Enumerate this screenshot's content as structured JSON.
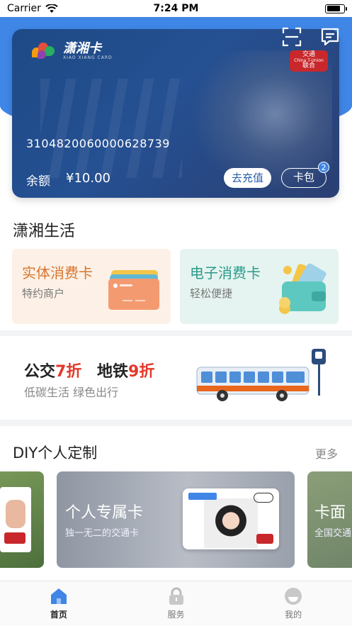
{
  "status_bar": {
    "carrier": "Carrier",
    "time": "7:24 PM"
  },
  "card": {
    "brand": "潇湘卡",
    "brand_sub": "XIAO XIANG CARD",
    "union_badge": [
      "交通",
      "China T-Union",
      "联合"
    ],
    "number": "3104820060000628739",
    "balance_label": "余额",
    "balance_value": "¥10.00",
    "recharge_label": "去充值",
    "wallet_label": "卡包",
    "wallet_count": "2"
  },
  "life": {
    "title": "潇湘生活",
    "physical": {
      "title": "实体消费卡",
      "subtitle": "特约商户"
    },
    "digital": {
      "title": "电子消费卡",
      "subtitle": "轻松便捷"
    }
  },
  "banner": {
    "bus_label": "公交",
    "bus_discount": "7折",
    "metro_label": "地铁",
    "metro_discount": "9折",
    "subtitle": "低碳生活 绿色出行"
  },
  "diy": {
    "title": "DIY个人定制",
    "more": "更多",
    "main_title": "个人专属卡",
    "main_subtitle": "独一无二的交通卡",
    "right_title": "卡面",
    "right_subtitle": "全国交通"
  },
  "tabbar": [
    {
      "label": "首页",
      "icon": "home-icon",
      "active": true
    },
    {
      "label": "服务",
      "icon": "lock-service-icon",
      "active": false
    },
    {
      "label": "我的",
      "icon": "profile-icon",
      "active": false
    }
  ],
  "colors": {
    "primary": "#3f86e6",
    "discount_red": "#e2392b",
    "orange": "#d8742c",
    "teal": "#2a9a8a"
  }
}
